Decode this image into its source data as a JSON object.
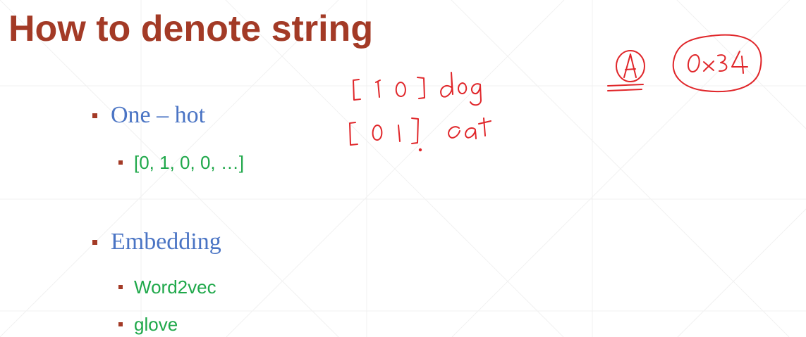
{
  "slide": {
    "title": "How to denote string",
    "bullets": [
      {
        "text": "One – hot",
        "sub": [
          "[0, 1, 0, 0, …]"
        ]
      },
      {
        "text": "Embedding",
        "sub": [
          "Word2vec",
          "glove"
        ]
      }
    ]
  },
  "annotations": {
    "vector_dog": "[1 0]",
    "label_dog": "dog",
    "vector_cat": "[0 1]",
    "label_cat": "cat",
    "circled_letter": "A",
    "circled_hex": "0x34"
  },
  "colors": {
    "title": "#a33a26",
    "bullet_l1_text": "#4a74c4",
    "bullet_l2_text": "#1fa84a",
    "bullet_marker": "#a33a26",
    "ink": "#e0262a",
    "grid_line": "#f2f2f2"
  }
}
